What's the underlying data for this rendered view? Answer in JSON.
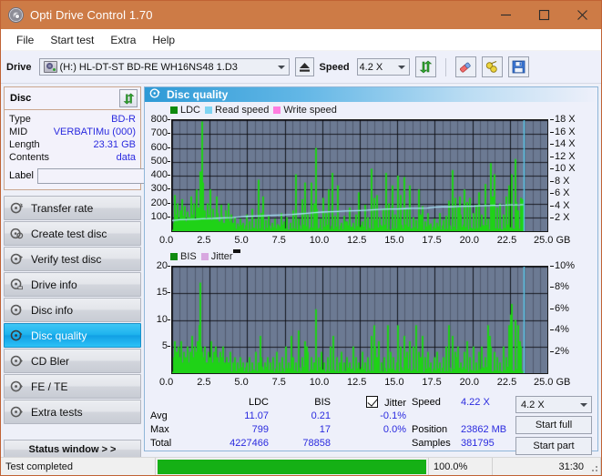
{
  "window": {
    "title": "Opti Drive Control 1.70",
    "icon": "disc-icon",
    "minimize": "minimize-icon",
    "maximize": "maximize-icon",
    "close": "close-icon"
  },
  "menu": {
    "items": [
      "File",
      "Start test",
      "Extra",
      "Help"
    ]
  },
  "toolbar": {
    "drive_label": "Drive",
    "drive_value": "(H:)  HL-DT-ST BD-RE  WH16NS48 1.D3",
    "eject_icon": "eject-icon",
    "speed_label": "Speed",
    "speed_value": "4.2 X",
    "refresh_icon": "refresh-icon",
    "erase_icon": "eraser-icon",
    "settings_icon": "plug-icon",
    "save_icon": "save-icon"
  },
  "sidebar": {
    "disc": {
      "title": "Disc",
      "refresh_icon": "refresh-icon",
      "rows": [
        {
          "key": "Type",
          "value": "BD-R"
        },
        {
          "key": "MID",
          "value": "VERBATIMu (000)"
        },
        {
          "key": "Length",
          "value": "23.31 GB"
        },
        {
          "key": "Contents",
          "value": "data"
        }
      ],
      "label_key": "Label",
      "label_value": "",
      "label_placeholder": "",
      "disc_icon": "cd-icon"
    },
    "nav": [
      {
        "label": "Transfer rate",
        "icon": "disc-rate-icon",
        "selected": false
      },
      {
        "label": "Create test disc",
        "icon": "disc-create-icon",
        "selected": false
      },
      {
        "label": "Verify test disc",
        "icon": "disc-verify-icon",
        "selected": false
      },
      {
        "label": "Drive info",
        "icon": "disc-drive-icon",
        "selected": false
      },
      {
        "label": "Disc info",
        "icon": "disc-info-icon",
        "selected": false
      },
      {
        "label": "Disc quality",
        "icon": "disc-quality-icon",
        "selected": true
      },
      {
        "label": "CD Bler",
        "icon": "disc-bler-icon",
        "selected": false
      },
      {
        "label": "FE / TE",
        "icon": "disc-fete-icon",
        "selected": false
      },
      {
        "label": "Extra tests",
        "icon": "disc-extra-icon",
        "selected": false
      }
    ],
    "status_window_button": "Status window > >"
  },
  "panel": {
    "title": "Disc quality",
    "title_icon": "disc-quality-icon"
  },
  "stats": {
    "col_headers": [
      "LDC",
      "BIS"
    ],
    "row_labels": [
      "Avg",
      "Max",
      "Total"
    ],
    "ldc": {
      "avg": "11.07",
      "max": "799",
      "total": "4227466"
    },
    "bis": {
      "avg": "0.21",
      "max": "17",
      "total": "78858"
    },
    "jitter": {
      "checkbox_label": "Jitter",
      "checked": true,
      "avg": "-0.1%",
      "max": "0.0%"
    },
    "speed_label": "Speed",
    "speed_value": "4.22 X",
    "position_label": "Position",
    "position_value": "23862 MB",
    "samples_label": "Samples",
    "samples_value": "381795",
    "speed_select": "4.2 X",
    "start_full": "Start full",
    "start_part": "Start part"
  },
  "statusbar": {
    "message": "Test completed",
    "percent": "100.0%",
    "progress": 100,
    "elapsed": "31:30"
  },
  "colors": {
    "title_bar": "#cd7b46",
    "plot_bg": "#6c7a93",
    "ldc_green": "#1fd217",
    "read_speed": "#7fd4f2",
    "write_speed": "#ff7de0",
    "selection": "#1fb4ee",
    "value_blue": "#2a2adf",
    "progress_green": "#15b015"
  },
  "chart_data": [
    {
      "type": "bar",
      "id": "ldc-chart",
      "title": "",
      "legend": [
        {
          "label": "LDC",
          "color": "#0f8a0f"
        },
        {
          "label": "Read speed",
          "color": "#7fd4f2"
        },
        {
          "label": "Write speed",
          "color": "#ff7de0"
        }
      ],
      "legend_position": "top-left",
      "xlabel": "GB",
      "ylabel": "",
      "xlim": [
        0,
        25
      ],
      "ylim": [
        0,
        800
      ],
      "y2lim": [
        0,
        18
      ],
      "y2label": "X",
      "xticks": [
        0.0,
        2.5,
        5.0,
        7.5,
        10.0,
        12.5,
        15.0,
        17.5,
        20.0,
        22.5,
        25.0
      ],
      "xticklabels": [
        "0.0",
        "2.5",
        "5.0",
        "7.5",
        "10.0",
        "12.5",
        "15.0",
        "17.5",
        "20.0",
        "22.5",
        "25.0 GB"
      ],
      "yticks": [
        100,
        200,
        300,
        400,
        500,
        600,
        700,
        800
      ],
      "yticklabels": [
        "100",
        "200",
        "300",
        "400",
        "500",
        "600",
        "700",
        "800"
      ],
      "y2ticks": [
        2,
        4,
        6,
        8,
        10,
        12,
        14,
        16,
        18
      ],
      "y2ticklabels": [
        "2 X",
        "4 X",
        "6 X",
        "8 X",
        "10 X",
        "12 X",
        "14 X",
        "16 X",
        "18 X"
      ],
      "grid": true,
      "data_end_x": 23.4,
      "series": [
        {
          "name": "LDC",
          "color": "#1fd217",
          "kind": "bars",
          "x": [
            0.05,
            0.15,
            0.25,
            0.3,
            0.4,
            0.5,
            0.6,
            0.7,
            0.8,
            0.9,
            1.0,
            1.1,
            1.2,
            1.3,
            1.4,
            1.5,
            1.6,
            1.7,
            1.8,
            1.9,
            1.95,
            2.0,
            2.1,
            2.2,
            2.3,
            2.4,
            2.5,
            2.6,
            2.7,
            2.8,
            2.9,
            3.0,
            3.1,
            3.2,
            3.3,
            3.4,
            3.5,
            3.6,
            3.7,
            3.8,
            3.9,
            4.0,
            4.1,
            4.3,
            4.5,
            4.7,
            4.9,
            5.1,
            5.3,
            5.5,
            5.7,
            5.9,
            6.0,
            6.2,
            6.4,
            6.6,
            6.8,
            7.0,
            7.2,
            7.4,
            7.6,
            7.8,
            8.0,
            8.2,
            8.4,
            8.6,
            8.8,
            9.0,
            9.2,
            9.4,
            9.5,
            9.6,
            9.8,
            10.0,
            10.2,
            10.4,
            10.6,
            10.8,
            11.0,
            11.2,
            11.4,
            11.5,
            11.6,
            11.8,
            12.0,
            12.2,
            12.4,
            12.6,
            12.8,
            13.0,
            13.2,
            13.4,
            13.5,
            13.6,
            13.8,
            14.0,
            14.2,
            14.4,
            14.6,
            14.8,
            15.0,
            15.1,
            15.2,
            15.4,
            15.6,
            15.8,
            16.0,
            16.2,
            16.4,
            16.5,
            16.6,
            16.8,
            17.0,
            17.2,
            17.4,
            17.6,
            17.8,
            18.0,
            18.2,
            18.4,
            18.6,
            18.8,
            19.0,
            19.1,
            19.2,
            19.4,
            19.6,
            19.8,
            20.0,
            20.2,
            20.4,
            20.6,
            20.8,
            21.0,
            21.2,
            21.3,
            21.4,
            21.6,
            21.8,
            22.0,
            22.2,
            22.4,
            22.6,
            22.8,
            22.9,
            23.0,
            23.2,
            23.3
          ],
          "values": [
            60,
            260,
            120,
            200,
            90,
            150,
            230,
            110,
            180,
            70,
            140,
            100,
            250,
            120,
            200,
            90,
            300,
            170,
            430,
            210,
            790,
            350,
            150,
            90,
            200,
            120,
            300,
            80,
            160,
            100,
            250,
            130,
            70,
            190,
            110,
            60,
            150,
            90,
            200,
            70,
            120,
            60,
            100,
            55,
            90,
            60,
            120,
            70,
            160,
            90,
            370,
            130,
            250,
            80,
            110,
            60,
            90,
            50,
            130,
            70,
            100,
            60,
            150,
            410,
            90,
            230,
            350,
            120,
            350,
            200,
            600,
            160,
            90,
            240,
            130,
            300,
            420,
            110,
            330,
            60,
            110,
            70,
            70,
            170,
            60,
            120,
            280,
            70,
            190,
            100,
            450,
            240,
            80,
            260,
            100,
            160,
            420,
            200,
            330,
            120,
            400,
            90,
            260,
            390,
            160,
            330,
            100,
            80,
            300,
            120,
            180,
            70,
            130,
            55,
            90,
            60,
            130,
            80,
            110,
            220,
            440,
            240,
            170,
            250,
            120,
            300,
            210,
            240,
            130,
            190,
            280,
            120,
            340,
            90,
            490,
            250,
            410,
            170,
            200,
            120,
            250,
            330,
            410,
            520,
            210,
            150,
            240,
            230
          ]
        },
        {
          "name": "Read speed",
          "color": "#a9e3f7",
          "kind": "line",
          "x": [
            0.0,
            0.5,
            1.0,
            1.5,
            2.0,
            2.5,
            3.0,
            3.5,
            4.0,
            4.5,
            5.0,
            5.5,
            6.0,
            6.5,
            7.0,
            7.5,
            8.0,
            8.5,
            9.0,
            9.5,
            10.0,
            10.5,
            11.0,
            11.5,
            12.0,
            12.5,
            13.0,
            13.5,
            14.0,
            14.5,
            15.0,
            15.5,
            16.0,
            16.5,
            17.0,
            17.5,
            18.0,
            18.5,
            19.0,
            19.5,
            20.0,
            20.5,
            21.0,
            21.5,
            22.0,
            22.5,
            23.0,
            23.4
          ],
          "values": [
            1.7,
            1.85,
            1.9,
            1.95,
            2.0,
            2.05,
            2.1,
            2.15,
            2.2,
            2.3,
            2.4,
            2.45,
            2.5,
            2.55,
            2.6,
            2.65,
            2.7,
            2.8,
            2.9,
            3.0,
            3.1,
            3.15,
            3.2,
            3.25,
            3.3,
            3.35,
            3.4,
            3.5,
            3.55,
            3.6,
            3.6,
            3.65,
            3.7,
            3.7,
            3.75,
            3.9,
            3.95,
            3.95,
            4.0,
            4.05,
            4.05,
            4.1,
            4.15,
            4.2,
            4.22,
            4.25,
            4.25,
            4.3
          ],
          "axis": "y2"
        },
        {
          "name": "Write speed",
          "color": "#ff7de0",
          "kind": "line",
          "x": [],
          "values": [],
          "axis": "y2"
        },
        {
          "name": "End marker",
          "color": "#5fd2f5",
          "kind": "vline",
          "x": [
            23.4
          ],
          "values": [
            18
          ]
        }
      ]
    },
    {
      "type": "bar",
      "id": "bis-chart",
      "title": "",
      "legend": [
        {
          "label": "BIS",
          "color": "#0f8a0f"
        },
        {
          "label": "Jitter",
          "color": "#d8a8e0"
        }
      ],
      "legend_position": "top-left",
      "xlabel": "GB",
      "ylabel": "",
      "xlim": [
        0,
        25
      ],
      "ylim": [
        0,
        20
      ],
      "y2lim": [
        0,
        10
      ],
      "y2label": "%",
      "xticks": [
        0.0,
        2.5,
        5.0,
        7.5,
        10.0,
        12.5,
        15.0,
        17.5,
        20.0,
        22.5,
        25.0
      ],
      "xticklabels": [
        "0.0",
        "2.5",
        "5.0",
        "7.5",
        "10.0",
        "12.5",
        "15.0",
        "17.5",
        "20.0",
        "22.5",
        "25.0 GB"
      ],
      "yticks": [
        5,
        10,
        15,
        20
      ],
      "yticklabels": [
        "5",
        "10",
        "15",
        "20"
      ],
      "y2ticks": [
        2,
        4,
        6,
        8,
        10
      ],
      "y2ticklabels": [
        "2%",
        "4%",
        "6%",
        "8%",
        "10%"
      ],
      "grid": true,
      "data_end_x": 23.4,
      "series": [
        {
          "name": "BIS",
          "color": "#1fd217",
          "kind": "bars",
          "x": [
            0.05,
            0.15,
            0.25,
            0.35,
            0.45,
            0.55,
            0.65,
            0.75,
            0.85,
            0.95,
            1.05,
            1.15,
            1.25,
            1.35,
            1.45,
            1.55,
            1.65,
            1.75,
            1.85,
            1.9,
            1.95,
            2.05,
            2.15,
            2.25,
            2.35,
            2.45,
            2.55,
            2.65,
            2.75,
            2.85,
            2.95,
            3.05,
            3.15,
            3.25,
            3.35,
            3.45,
            3.55,
            3.7,
            3.85,
            4.0,
            4.15,
            4.3,
            4.5,
            4.7,
            4.9,
            5.1,
            5.3,
            5.5,
            5.7,
            5.8,
            5.9,
            6.1,
            6.3,
            6.5,
            6.7,
            6.9,
            7.1,
            7.3,
            7.5,
            7.7,
            7.9,
            8.0,
            8.2,
            8.4,
            8.6,
            8.8,
            8.9,
            9.0,
            9.2,
            9.4,
            9.55,
            9.7,
            9.9,
            10.1,
            10.3,
            10.5,
            10.7,
            10.9,
            11.1,
            11.2,
            11.4,
            11.6,
            11.8,
            12.0,
            12.2,
            12.4,
            12.6,
            12.8,
            13.0,
            13.2,
            13.4,
            13.5,
            13.6,
            13.7,
            13.9,
            14.1,
            14.3,
            14.5,
            14.7,
            14.9,
            15.0,
            15.2,
            15.4,
            15.5,
            15.6,
            15.8,
            16.0,
            16.2,
            16.4,
            16.5,
            16.6,
            16.8,
            17.0,
            17.2,
            17.4,
            17.6,
            17.8,
            18.0,
            18.2,
            18.4,
            18.6,
            18.8,
            18.9,
            19.0,
            19.2,
            19.4,
            19.6,
            19.8,
            20.0,
            20.2,
            20.4,
            20.6,
            20.8,
            21.0,
            21.1,
            21.2,
            21.4,
            21.6,
            21.8,
            22.0,
            22.2,
            22.4,
            22.5,
            22.6,
            22.8,
            23.0,
            23.1,
            23.2,
            23.3
          ],
          "values": [
            3,
            6,
            4,
            5,
            3,
            6,
            2,
            4,
            3,
            5,
            2,
            4,
            7,
            3,
            5,
            4,
            6,
            9,
            17,
            5,
            4,
            3,
            5,
            2,
            4,
            3,
            6,
            2,
            4,
            5,
            3,
            2,
            4,
            3,
            5,
            2,
            3,
            2,
            4,
            2,
            3,
            2,
            3,
            2,
            2,
            3,
            2,
            4,
            2,
            7,
            3,
            2,
            3,
            2,
            3,
            4,
            2,
            3,
            5,
            2,
            7,
            3,
            2,
            8,
            3,
            6,
            5,
            4,
            3,
            2,
            12,
            3,
            4,
            2,
            3,
            5,
            7,
            3,
            2,
            4,
            2,
            3,
            2,
            5,
            3,
            2,
            4,
            2,
            3,
            7,
            9,
            5,
            3,
            6,
            2,
            3,
            9,
            4,
            3,
            2,
            9,
            5,
            7,
            3,
            4,
            6,
            5,
            9,
            4,
            3,
            7,
            3,
            4,
            2,
            3,
            4,
            2,
            3,
            5,
            9,
            7,
            4,
            3,
            5,
            2,
            4,
            6,
            3,
            5,
            2,
            4,
            5,
            3,
            9,
            7,
            5,
            4,
            3,
            2,
            5,
            3,
            9,
            11,
            13,
            10,
            9,
            6,
            5
          ]
        },
        {
          "name": "Jitter",
          "color": "#d8a8e0",
          "kind": "line",
          "x": [],
          "values": [],
          "axis": "y2"
        },
        {
          "name": "End marker",
          "color": "#5fd2f5",
          "kind": "vline",
          "x": [
            23.4
          ],
          "values": [
            20
          ]
        }
      ]
    }
  ]
}
